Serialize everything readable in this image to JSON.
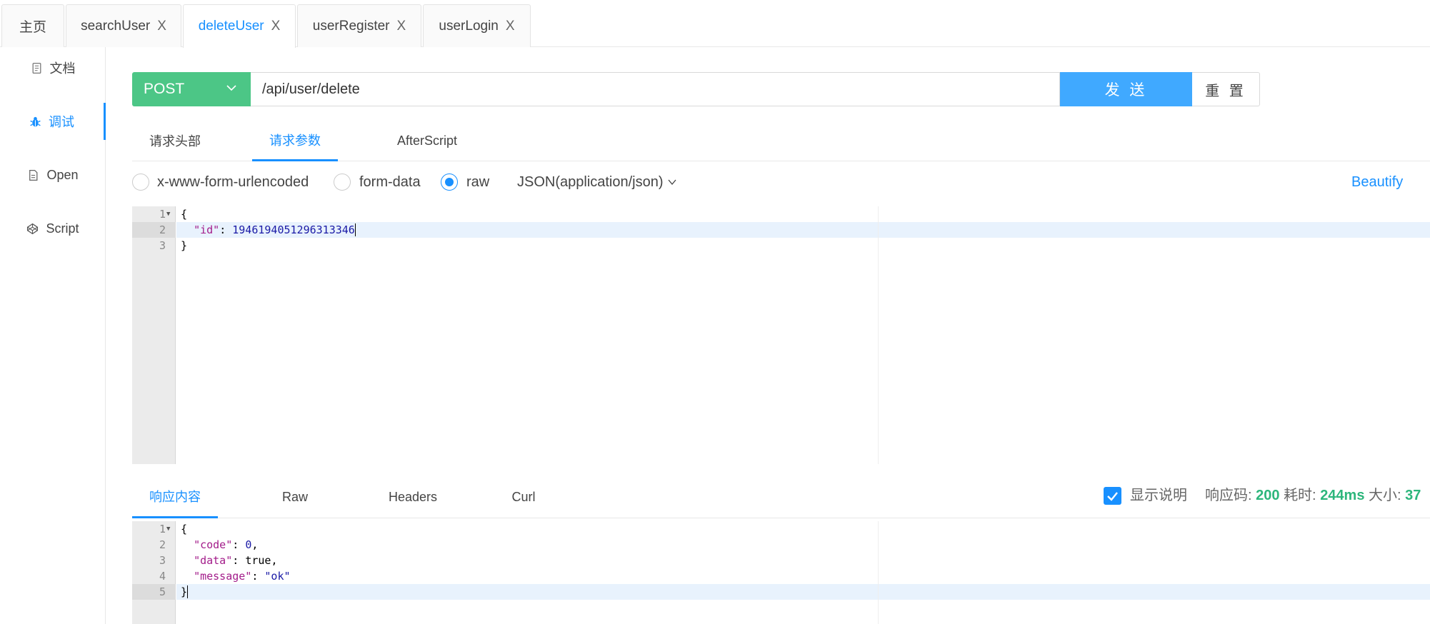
{
  "tabs": [
    {
      "label": "主页",
      "closable": false
    },
    {
      "label": "searchUser",
      "closable": true
    },
    {
      "label": "deleteUser",
      "closable": true,
      "active": true
    },
    {
      "label": "userRegister",
      "closable": true
    },
    {
      "label": "userLogin",
      "closable": true
    }
  ],
  "close_glyph": "X",
  "sidebar": {
    "items": [
      {
        "label": "文档",
        "icon": "document-icon"
      },
      {
        "label": "调试",
        "icon": "bug-icon",
        "active": true
      },
      {
        "label": "Open",
        "icon": "file-icon"
      },
      {
        "label": "Script",
        "icon": "codepen-icon"
      }
    ]
  },
  "request": {
    "method": "POST",
    "url": "/api/user/delete",
    "send_label": "发 送",
    "reset_label": "重 置"
  },
  "param_tabs": [
    "请求头部",
    "请求参数",
    "AfterScript"
  ],
  "body_types": {
    "options": [
      "x-www-form-urlencoded",
      "form-data",
      "raw"
    ],
    "selected": "raw",
    "content_type": "JSON(application/json)",
    "beautify_label": "Beautify"
  },
  "request_body": {
    "line_numbers": [
      "1",
      "2",
      "3"
    ],
    "open_brace": "{",
    "id_key": "\"id\"",
    "id_value": "1946194051296313346",
    "close_brace": "}"
  },
  "response_tabs": [
    "响应内容",
    "Raw",
    "Headers",
    "Curl"
  ],
  "response_meta": {
    "show_desc_label": "显示说明",
    "show_desc_checked": true,
    "code_label": "响应码:",
    "code_value": "200",
    "time_label": "耗时:",
    "time_value": "244ms",
    "size_label": "大小:",
    "size_value": "37"
  },
  "response_body": {
    "line_numbers": [
      "1",
      "2",
      "3",
      "4",
      "5"
    ],
    "open_brace": "{",
    "code_key": "\"code\"",
    "code_value": "0",
    "data_key": "\"data\"",
    "data_value": "true",
    "message_key": "\"message\"",
    "message_value": "\"ok\"",
    "close_brace": "}"
  },
  "colors": {
    "accent": "#1890ff",
    "method_bg": "#4cc686",
    "send_bg": "#40a9ff",
    "success": "#2db67c"
  }
}
